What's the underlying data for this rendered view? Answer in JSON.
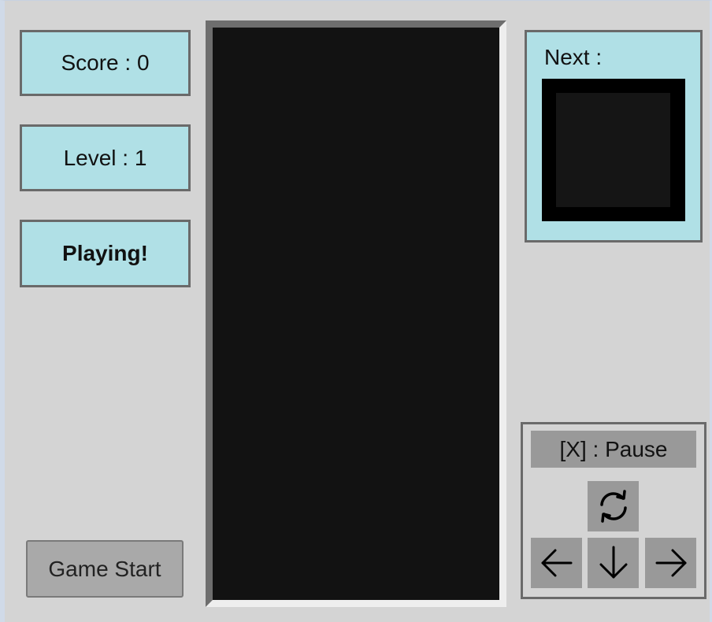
{
  "score": {
    "text": "Score : 0"
  },
  "level": {
    "text": "Level : 1"
  },
  "status": {
    "text": "Playing!"
  },
  "start_button": {
    "label": "Game Start"
  },
  "next": {
    "label": "Next :"
  },
  "controls": {
    "pause_label": "[X] : Pause",
    "rotate_icon": "rotate-icon",
    "left_icon": "arrow-left-icon",
    "down_icon": "arrow-down-icon",
    "right_icon": "arrow-right-icon"
  },
  "colors": {
    "panel_bg": "#b0e0e6",
    "board_bg": "#121212",
    "window_bg": "#d4d4d4",
    "button_bg": "#999999"
  }
}
